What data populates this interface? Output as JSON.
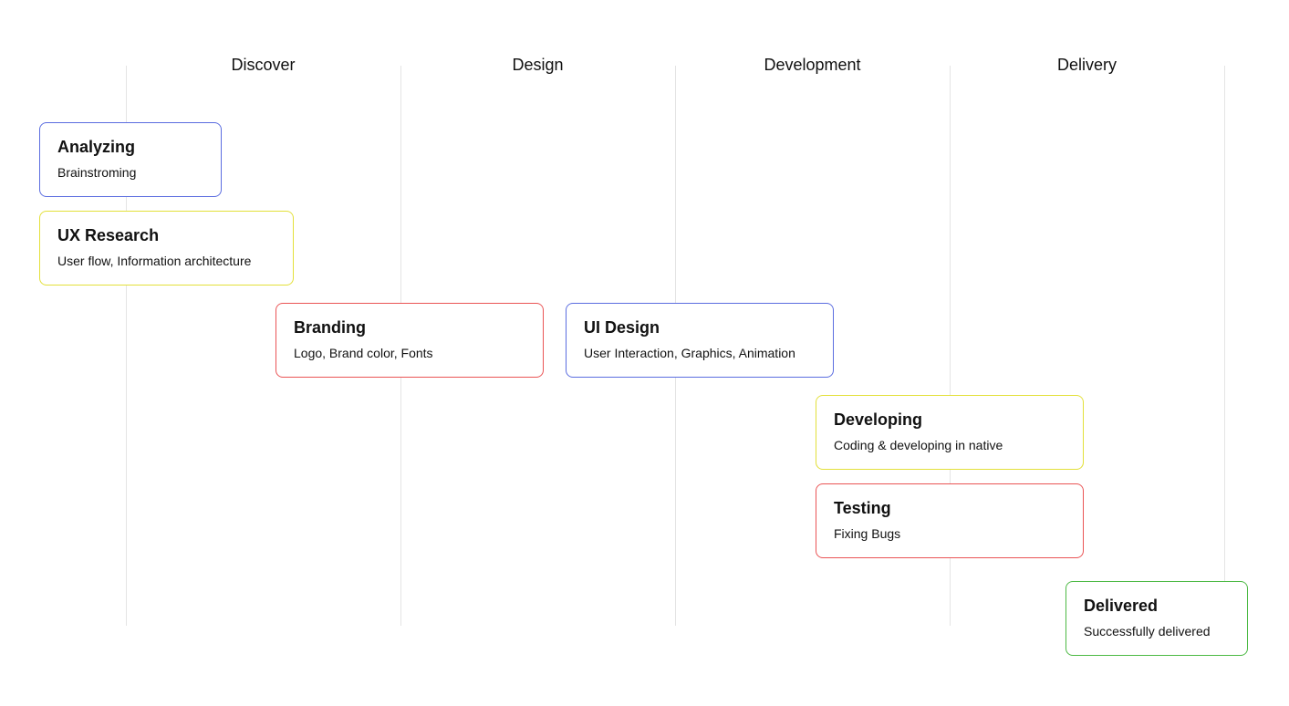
{
  "phases": [
    {
      "label": "Discover"
    },
    {
      "label": "Design"
    },
    {
      "label": "Development"
    },
    {
      "label": "Delivery"
    }
  ],
  "colors": {
    "blue": "#5b6de0",
    "yellow": "#e3e03a",
    "red": "#ea5455",
    "green": "#4cb944",
    "gridline": "#e4e4e4"
  },
  "tasks": [
    {
      "title": "Analyzing",
      "subtitle": "Brainstroming",
      "color": "#5b6de0"
    },
    {
      "title": "UX Research",
      "subtitle": "User flow, Information architecture",
      "color": "#e3e03a"
    },
    {
      "title": "Branding",
      "subtitle": "Logo, Brand color, Fonts",
      "color": "#ea5455"
    },
    {
      "title": "UI Design",
      "subtitle": "User Interaction, Graphics, Animation",
      "color": "#5b6de0"
    },
    {
      "title": "Developing",
      "subtitle": "Coding & developing in native",
      "color": "#e3e03a"
    },
    {
      "title": "Testing",
      "subtitle": "Fixing Bugs",
      "color": "#ea5455"
    },
    {
      "title": "Delivered",
      "subtitle": "Successfully delivered",
      "color": "#4cb944"
    }
  ]
}
